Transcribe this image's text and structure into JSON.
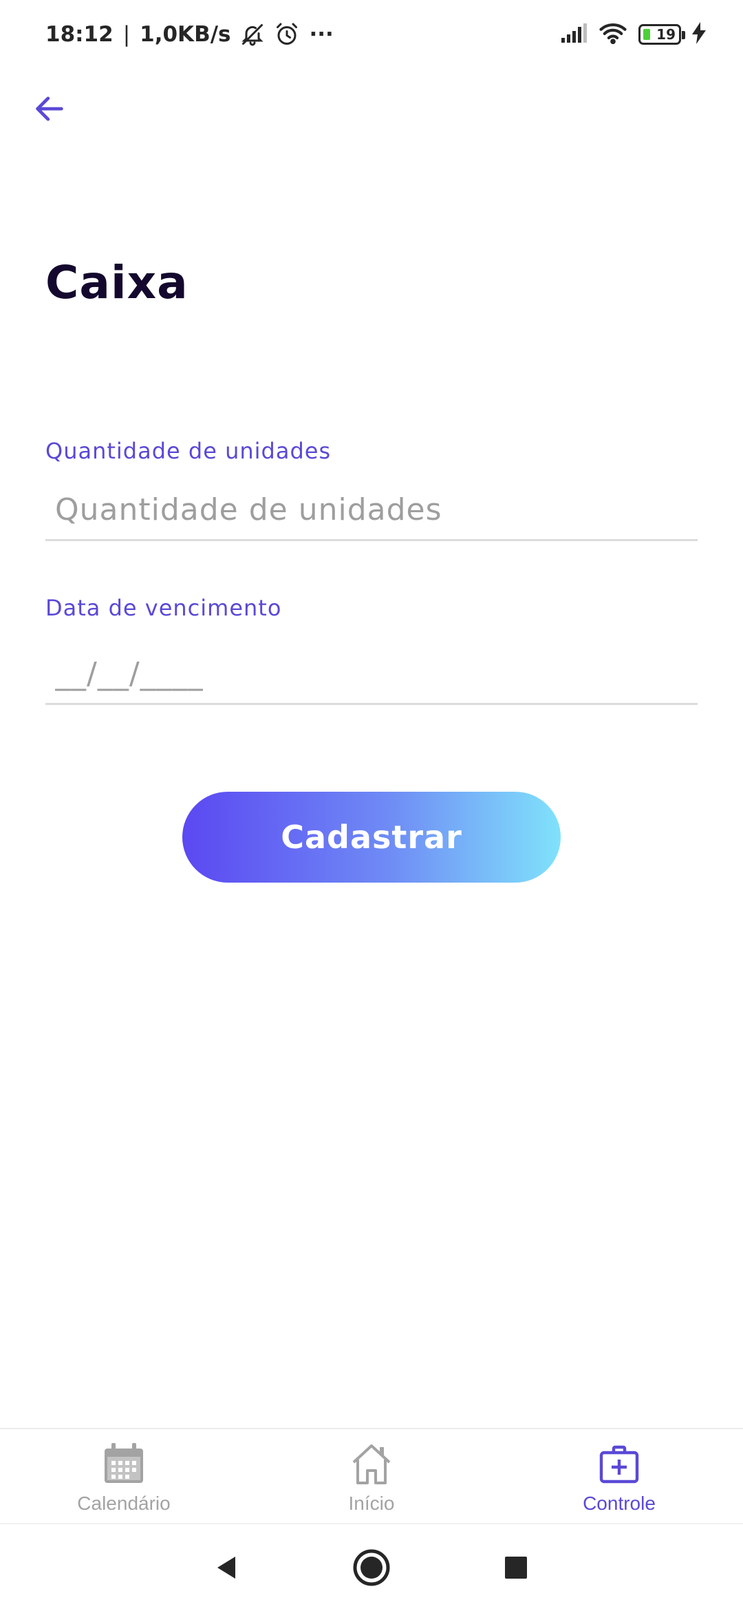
{
  "status_bar": {
    "time": "18:12",
    "separator": "|",
    "speed": "1,0KB/s",
    "more": "···",
    "battery_level": "19",
    "icons": [
      "bell-off-icon",
      "alarm-icon",
      "signal-icon",
      "wifi-icon",
      "battery-icon",
      "charging-icon"
    ]
  },
  "header": {
    "back_icon": "arrow-left-icon",
    "title": "Caixa"
  },
  "form": {
    "quantity": {
      "label": "Quantidade de unidades",
      "placeholder": "Quantidade de unidades",
      "value": ""
    },
    "expiry": {
      "label": "Data de vencimento",
      "placeholder": "__/__/____",
      "value": ""
    },
    "submit_label": "Cadastrar"
  },
  "bottom_nav": {
    "items": [
      {
        "label": "Calendário",
        "icon": "calendar-icon",
        "active": false
      },
      {
        "label": "Início",
        "icon": "home-icon",
        "active": false
      },
      {
        "label": "Controle",
        "icon": "first-aid-kit-icon",
        "active": true
      }
    ]
  },
  "colors": {
    "accent": "#5a49d6",
    "title": "#14082e",
    "gradient_start": "#5b48f2",
    "gradient_end": "#80e2fb",
    "inactive": "#a3a3a3"
  }
}
